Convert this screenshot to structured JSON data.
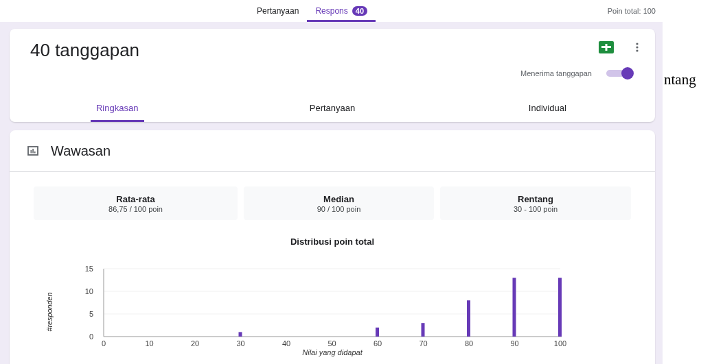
{
  "top_tabs": [
    {
      "label": "Pertanyaan",
      "selected": false
    },
    {
      "label": "Respons",
      "selected": true,
      "badge": "40"
    }
  ],
  "total_points": "Poin total: 100",
  "summary": {
    "title": "40 tanggapan",
    "accepting": {
      "label": "Menerima tanggapan",
      "on": true
    },
    "tabs": [
      {
        "label": "Ringkasan",
        "selected": true
      },
      {
        "label": "Pertanyaan",
        "selected": false
      },
      {
        "label": "Individual",
        "selected": false
      }
    ]
  },
  "insights": {
    "title": "Wawasan",
    "stats": [
      {
        "label": "Rata-rata",
        "value": "86,75 / 100 poin"
      },
      {
        "label": "Median",
        "value": "90 / 100 poin"
      },
      {
        "label": "Rentang",
        "value": "30 - 100 poin"
      }
    ],
    "chart_data": {
      "type": "bar",
      "title": "Distribusi poin total",
      "xlabel": "Nilai yang didapat",
      "ylabel": "#responden",
      "x": [
        30,
        60,
        70,
        80,
        90,
        100
      ],
      "series": [
        {
          "color": "#673ab7",
          "values": [
            1,
            2,
            3,
            8,
            13,
            13
          ]
        }
      ],
      "xlim": [
        0,
        100
      ],
      "ylim": [
        0,
        15
      ],
      "xticks": [
        0,
        10,
        20,
        30,
        40,
        50,
        60,
        70,
        80,
        90,
        100
      ],
      "yticks": [
        0,
        5,
        10,
        15
      ]
    }
  },
  "side_text": "ntang"
}
